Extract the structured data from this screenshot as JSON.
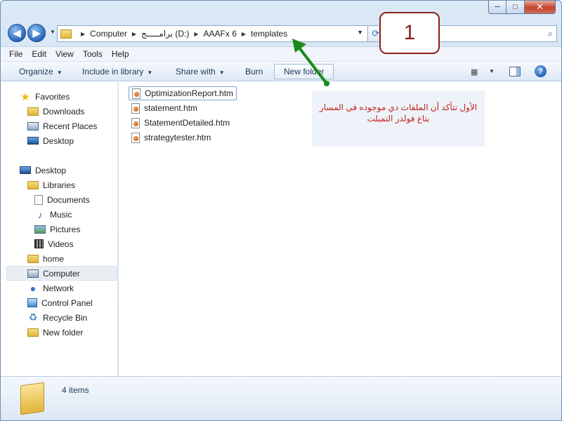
{
  "window": {
    "caption": {
      "minimize": "─",
      "maximize": "□",
      "close": "✕"
    }
  },
  "nav": {
    "back_icon": "arrow-left-icon",
    "forward_icon": "arrow-right-icon",
    "back_glyph": "◀",
    "forward_glyph": "▶"
  },
  "address": {
    "crumbs": [
      "Computer",
      "برامـــــج (D:)",
      "AAAFx 6",
      "templates"
    ],
    "separator": "▶",
    "dropdown": "▼"
  },
  "search": {
    "placeholder": "ates",
    "icon_glyph": "⌕"
  },
  "refresh": {
    "glyph": "⟳"
  },
  "menubar": {
    "items": [
      "File",
      "Edit",
      "View",
      "Tools",
      "Help"
    ]
  },
  "commandbar": {
    "organize": "Organize",
    "include_in_library": "Include in library",
    "share_with": "Share with",
    "burn": "Burn",
    "new_folder": "New folder",
    "dropdown_glyph": "▼",
    "help_glyph": "?"
  },
  "sidebar": {
    "favorites": {
      "label": "Favorites",
      "items": [
        "Downloads",
        "Recent Places",
        "Desktop"
      ]
    },
    "desktop": "Desktop",
    "libraries": {
      "label": "Libraries",
      "items": [
        "Documents",
        "Music",
        "Pictures",
        "Videos"
      ]
    },
    "home": "home",
    "computer": "Computer",
    "network": "Network",
    "control_panel": "Control Panel",
    "recycle_bin": "Recycle Bin",
    "new_folder": "New folder",
    "selected": "Computer"
  },
  "files": [
    {
      "name": "OptimizationReport.htm",
      "focused": true
    },
    {
      "name": "statement.htm",
      "focused": false
    },
    {
      "name": "StatementDetailed.htm",
      "focused": false
    },
    {
      "name": "strategytester.htm",
      "focused": false
    }
  ],
  "annotation": {
    "callout_number": "1",
    "note_line1": "الأول نتأكد أن الملفات دي موجوده في المسار",
    "note_line2": "بتاع فولدر التمبلت",
    "arrow_color": "#1a8a1a",
    "note_color": "#c2241c"
  },
  "details": {
    "item_count": "4 items"
  }
}
